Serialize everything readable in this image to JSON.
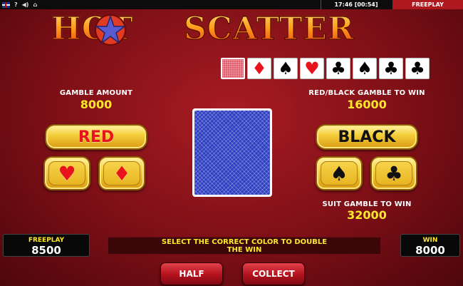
{
  "status_bar": {
    "time": "17:46 [00:54]",
    "mode": "FREEPLAY",
    "icons": [
      "uk-flag-icon",
      "help-icon",
      "sound-icon",
      "home-icon"
    ]
  },
  "logo": {
    "word1": "HOT",
    "word2": "SCATTER"
  },
  "history": [
    {
      "type": "back"
    },
    {
      "suit": "♦",
      "color": "red"
    },
    {
      "suit": "♠",
      "color": "black"
    },
    {
      "suit": "♥",
      "color": "red"
    },
    {
      "suit": "♣",
      "color": "black"
    },
    {
      "suit": "♠",
      "color": "black"
    },
    {
      "suit": "♣",
      "color": "black"
    },
    {
      "suit": "♣",
      "color": "black"
    }
  ],
  "gamble_amount": {
    "label": "GAMBLE AMOUNT",
    "value": "8000"
  },
  "red_black": {
    "label": "RED/BLACK GAMBLE TO WIN",
    "value": "16000"
  },
  "suit_gamble": {
    "label": "SUIT GAMBLE TO WIN",
    "value": "32000"
  },
  "buttons": {
    "red": "RED",
    "black": "BLACK",
    "heart": "♥",
    "diamond": "♦",
    "spade": "♠",
    "club": "♣",
    "half": "HALF",
    "collect": "COLLECT"
  },
  "freeplay_panel": {
    "label": "FREEPLAY",
    "value": "8500"
  },
  "win_panel": {
    "label": "WIN",
    "value": "8000"
  },
  "message": {
    "line1": "SELECT THE CORRECT COLOR TO DOUBLE",
    "line2": "THE WIN"
  },
  "colors": {
    "red": "#e8131d",
    "accent_yellow": "#ffe82a",
    "bar_red": "#b01820"
  }
}
